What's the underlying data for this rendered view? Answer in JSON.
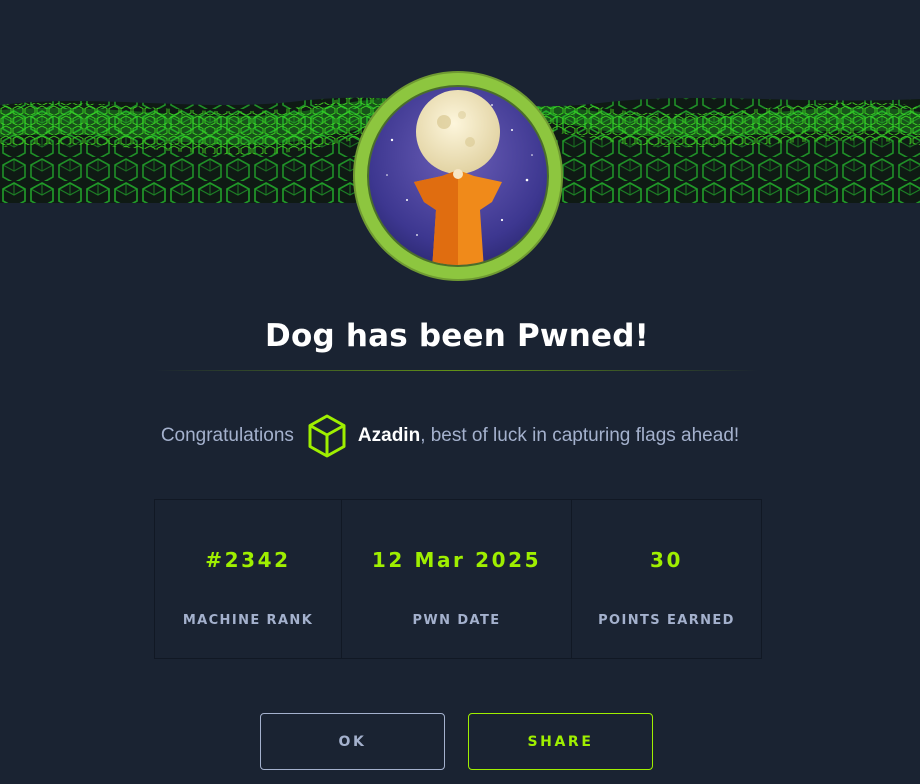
{
  "dialog": {
    "title": "Dog has been Pwned!",
    "congrats_prefix": "Congratulations",
    "username": "Azadin",
    "congrats_suffix": ", best of luck in capturing flags ahead!"
  },
  "stats": [
    {
      "value": "#2342",
      "label": "MACHINE RANK"
    },
    {
      "value": "12 Mar 2025",
      "label": "PWN DATE"
    },
    {
      "value": "30",
      "label": "POINTS EARNED"
    }
  ],
  "buttons": {
    "ok_label": "OK",
    "share_label": "SHARE"
  },
  "colors": {
    "background": "#1a2332",
    "accent_green": "#9fef00",
    "muted_text": "#a4b1cd",
    "avatar_ring": "#8dc63f"
  },
  "icons": {
    "user_rank": "hexagon-cube-icon",
    "machine_avatar": "dog-moon-avatar"
  }
}
